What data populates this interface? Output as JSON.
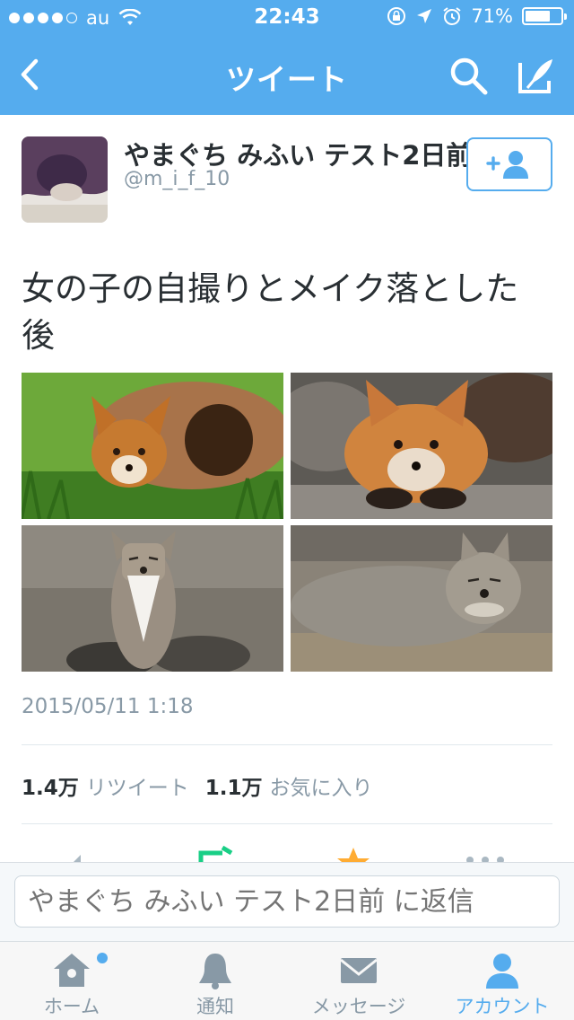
{
  "status_bar": {
    "carrier": "au",
    "time": "22:43",
    "battery": "71%",
    "battery_level": 0.71
  },
  "nav": {
    "title": "ツイート",
    "back_icon": "chevron-left-icon",
    "search_icon": "search-icon",
    "compose_icon": "compose-icon"
  },
  "tweet": {
    "user_name": "やまぐち みふい テスト2日前",
    "handle": "@m_i_f_10",
    "text": "女の子の自撮りとメイク落とした後",
    "timestamp": "2015/05/11 1:18",
    "photos": [
      "fox-kit-in-log",
      "fox-kit-on-rock",
      "tibetan-fox-sitting",
      "tibetan-fox-lying"
    ]
  },
  "stats": {
    "retweet_count": "1.4万",
    "retweet_label": "リツイート",
    "favorite_count": "1.1万",
    "favorite_label": "お気に入り"
  },
  "reply": {
    "placeholder": "やまぐち みふい テスト2日前 に返信"
  },
  "tabbar": {
    "items": [
      {
        "label": "ホーム",
        "icon": "home-icon"
      },
      {
        "label": "通知",
        "icon": "bell-icon"
      },
      {
        "label": "メッセージ",
        "icon": "envelope-icon"
      },
      {
        "label": "アカウント",
        "icon": "person-icon"
      }
    ],
    "active_index": 3
  },
  "colors": {
    "brand": "#55acee",
    "text": "#292f33",
    "muted": "#8899a6"
  }
}
